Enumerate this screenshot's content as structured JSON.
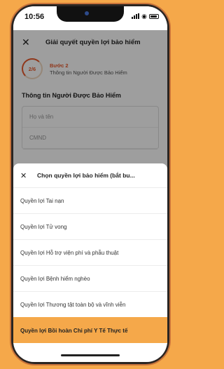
{
  "status_bar": {
    "time": "10:56"
  },
  "header": {
    "close_icon": "close-icon",
    "title": "Giải quyết quyền lợi bảo hiểm"
  },
  "step": {
    "progress": "2/6",
    "label": "Bước 2",
    "subtitle": "Thông tin Người Được Bảo Hiểm"
  },
  "section": {
    "title": "Thông tin Người Được Bảo Hiểm",
    "fields": [
      {
        "placeholder": "Họ và tên"
      },
      {
        "placeholder": "CMND"
      }
    ]
  },
  "sheet": {
    "close_icon": "close-icon",
    "title": "Chọn quyền lợi bảo hiểm (bắt bu...",
    "options": [
      {
        "label": "Quyền lợi Tai nạn",
        "selected": false
      },
      {
        "label": "Quyền lợi Tử vong",
        "selected": false
      },
      {
        "label": "Quyền lợi Hỗ trợ viện phí và phẫu thuật",
        "selected": false
      },
      {
        "label": "Quyền lợi Bệnh hiểm nghèo",
        "selected": false
      },
      {
        "label": "Quyền lợi Thương tật toàn bộ và vĩnh viễn",
        "selected": false
      },
      {
        "label": "Quyền lợi Bồi hoàn Chi phí Y Tế Thực tế",
        "selected": true
      }
    ]
  },
  "colors": {
    "accent": "#f5a84a",
    "step_accent": "#e85a2c"
  }
}
